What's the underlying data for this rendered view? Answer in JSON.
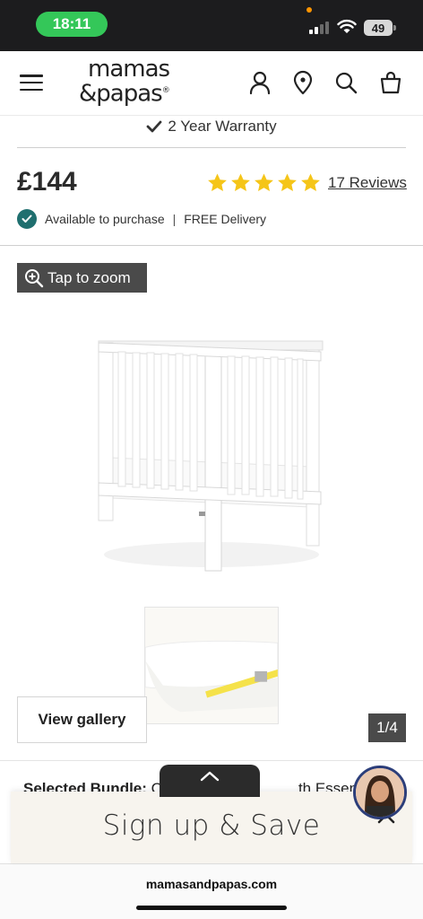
{
  "status_bar": {
    "time": "18:11",
    "battery": "49",
    "icons": [
      "signal-icon",
      "wifi-icon",
      "battery-icon"
    ]
  },
  "header": {
    "logo_line1": "mamas",
    "logo_line2": "&papas",
    "logo_reg": "®",
    "icons": [
      "menu-icon",
      "account-icon",
      "store-locator-icon",
      "search-icon",
      "bag-icon"
    ]
  },
  "product": {
    "warranty": "2 Year Warranty",
    "price": "£144",
    "rating": 5,
    "rating_max": 5,
    "reviews": "17 Reviews",
    "availability": "Available to purchase",
    "separator": "|",
    "delivery": "FREE Delivery",
    "star_color": "#f5c518",
    "check_color": "#1f6f6f"
  },
  "gallery": {
    "zoom_label": "Tap to zoom",
    "view_gallery": "View gallery",
    "counter": "1/4"
  },
  "bundle": {
    "label": "Selected Bundle:",
    "visible_start": "C",
    "visible_end": "th Essential A"
  },
  "signup": {
    "title": "Sign up & Save"
  },
  "browser": {
    "url": "mamasandpapas.com"
  }
}
